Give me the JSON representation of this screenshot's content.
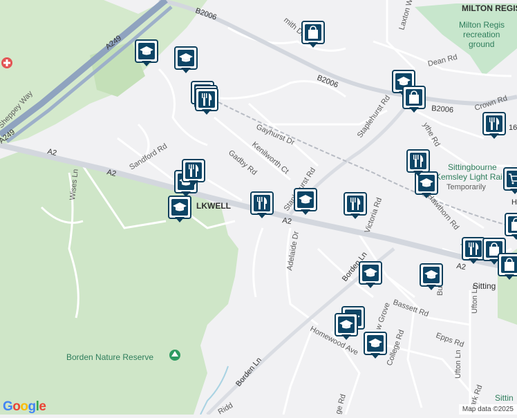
{
  "map": {
    "road_labels": {
      "b2006_nw": "B2006",
      "b2006_mid": "B2006",
      "b2006_e": "B2006",
      "a249": "A249",
      "a2_w": "A2",
      "a2_w2": "A2",
      "a2_mid": "A2",
      "a2_e": "A2",
      "a249_low": "A249",
      "sheppey_way": "Sheppey Way",
      "sandford_rd": "Sandford Rd",
      "wises_ln": "Wises Ln",
      "gadby_rd": "Gadby Rd",
      "gayhurst_dr": "Gayhurst Dr",
      "kenilworth_ct": "Kenilworth Ct",
      "staplehurst_rd_n": "Staplehurst Rd",
      "staplehurst_rd_s": "Staplehurst Rd",
      "adelaide_dr": "Adelaide Dr",
      "victoria_rd": "Victoria Rd",
      "borden_ln_n": "Borden Ln",
      "borden_ln_s": "Borden Ln",
      "bassett_rd": "Bassett Rd",
      "homewood_ave": "Homewood Ave",
      "college_rd": "College Rd",
      "epps_rd": "Epps Rd",
      "ufton_ln_n": "Ufton Ln",
      "ufton_ln_s": "Ufton Ln",
      "park_rd": "Park Rd",
      "hawthorn_rd": "Hawthorn Rd",
      "dean_rd": "Dean Rd",
      "crown_rd": "Crown Rd",
      "laxton_way": "Laxton Way",
      "grove": "w Grove",
      "ridd": "Ridd",
      "ge_rd": "ge Rd",
      "ythe_rd": "ythe Rd",
      "smith_dr": "mith Dr",
      "bu": "Bu",
      "fragment_16": "16",
      "fragment_h": "H",
      "fragment_t": "T"
    },
    "place_labels": {
      "milton_regis": "MILTON REGIS",
      "park_line1": "Milton Regis",
      "park_line2": "recreation",
      "park_line3": "ground",
      "tunstall": "LKWELL",
      "sittingbourne_station_line1": "Sittingbourne",
      "sittingbourne_station_line2": "Kemsley Light Rai",
      "sittingbourne_station_line3": "Temporarily",
      "sittingbourne_town": "Sitting",
      "borden_nature_reserve": "Borden Nature Reserve",
      "sittin_bottom": "Sittin"
    },
    "markers": [
      {
        "kind": "school",
        "icon": "graduation-cap-icon"
      },
      {
        "kind": "school",
        "icon": "graduation-cap-icon"
      },
      {
        "kind": "restaurant",
        "icon": "fork-knife-icon"
      },
      {
        "kind": "restaurant",
        "icon": "fork-knife-icon"
      },
      {
        "kind": "restaurant",
        "icon": "fork-knife-icon"
      },
      {
        "kind": "school",
        "icon": "graduation-cap-icon"
      },
      {
        "kind": "school",
        "icon": "graduation-cap-icon"
      },
      {
        "kind": "restaurant",
        "icon": "fork-knife-icon"
      },
      {
        "kind": "school",
        "icon": "graduation-cap-icon"
      },
      {
        "kind": "restaurant",
        "icon": "fork-knife-icon"
      },
      {
        "kind": "restaurant",
        "icon": "fork-knife-icon"
      },
      {
        "kind": "shopping",
        "icon": "shopping-bag-icon"
      },
      {
        "kind": "school",
        "icon": "graduation-cap-icon"
      },
      {
        "kind": "shopping",
        "icon": "shopping-bag-icon"
      },
      {
        "kind": "restaurant",
        "icon": "fork-knife-icon"
      },
      {
        "kind": "restaurant",
        "icon": "fork-knife-icon"
      },
      {
        "kind": "school",
        "icon": "graduation-cap-icon"
      },
      {
        "kind": "shopping",
        "icon": "shopping-cart-icon"
      },
      {
        "kind": "school",
        "icon": "graduation-cap-icon"
      },
      {
        "kind": "school",
        "icon": "graduation-cap-icon"
      },
      {
        "kind": "school",
        "icon": "graduation-cap-icon"
      },
      {
        "kind": "school",
        "icon": "graduation-cap-icon"
      },
      {
        "kind": "school",
        "icon": "graduation-cap-icon"
      },
      {
        "kind": "restaurant",
        "icon": "fork-knife-icon"
      },
      {
        "kind": "shopping",
        "icon": "shopping-bag-icon"
      },
      {
        "kind": "shopping",
        "icon": "shopping-bag-icon"
      },
      {
        "kind": "shopping",
        "icon": "shopping-bag-icon"
      }
    ],
    "colors": {
      "background": "#f1f1f3",
      "green": "#cfe6c8",
      "park_green": "#c7e6cc",
      "motorway": "#8fa3bf",
      "major_road": "#d3d7de",
      "marker_fill": "#0d4566",
      "water": "#a9d3e3"
    }
  },
  "footer": {
    "logo": "Google",
    "attribution": "Map data ©2025"
  }
}
